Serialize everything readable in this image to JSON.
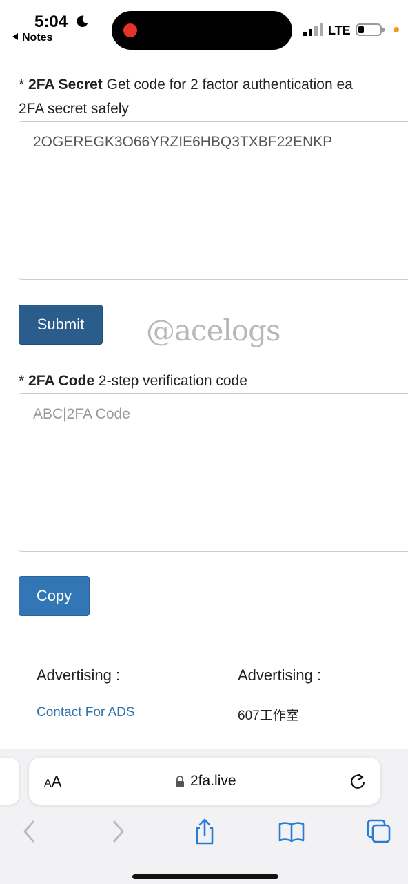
{
  "status_bar": {
    "time": "5:04",
    "back_app": "Notes",
    "carrier": "LTE"
  },
  "form": {
    "secret_label_bold": "2FA Secret",
    "secret_label_text": " Get code for 2 factor authentication ea",
    "secret_label_line2": "2FA secret safely",
    "secret_value": "2OGEREGK3O66YRZIE6HBQ3TXBF22ENKP",
    "submit_label": "Submit",
    "code_label_bold": "2FA Code",
    "code_label_text": " 2-step verification code",
    "code_placeholder": "ABC|2FA Code",
    "copy_label": "Copy",
    "required_mark": "* "
  },
  "watermark": "@acelogs",
  "ads": {
    "col1_title": "Advertising :",
    "col1_link": "Contact For ADS",
    "col2_title": "Advertising :",
    "col2_text": "607工作室"
  },
  "browser": {
    "aa_label_small": "A",
    "aa_label_big": "A",
    "domain": "2fa.live"
  },
  "colors": {
    "submit_bg": "#2a5c8c",
    "copy_bg": "#3376b5",
    "link": "#2f72ad"
  }
}
